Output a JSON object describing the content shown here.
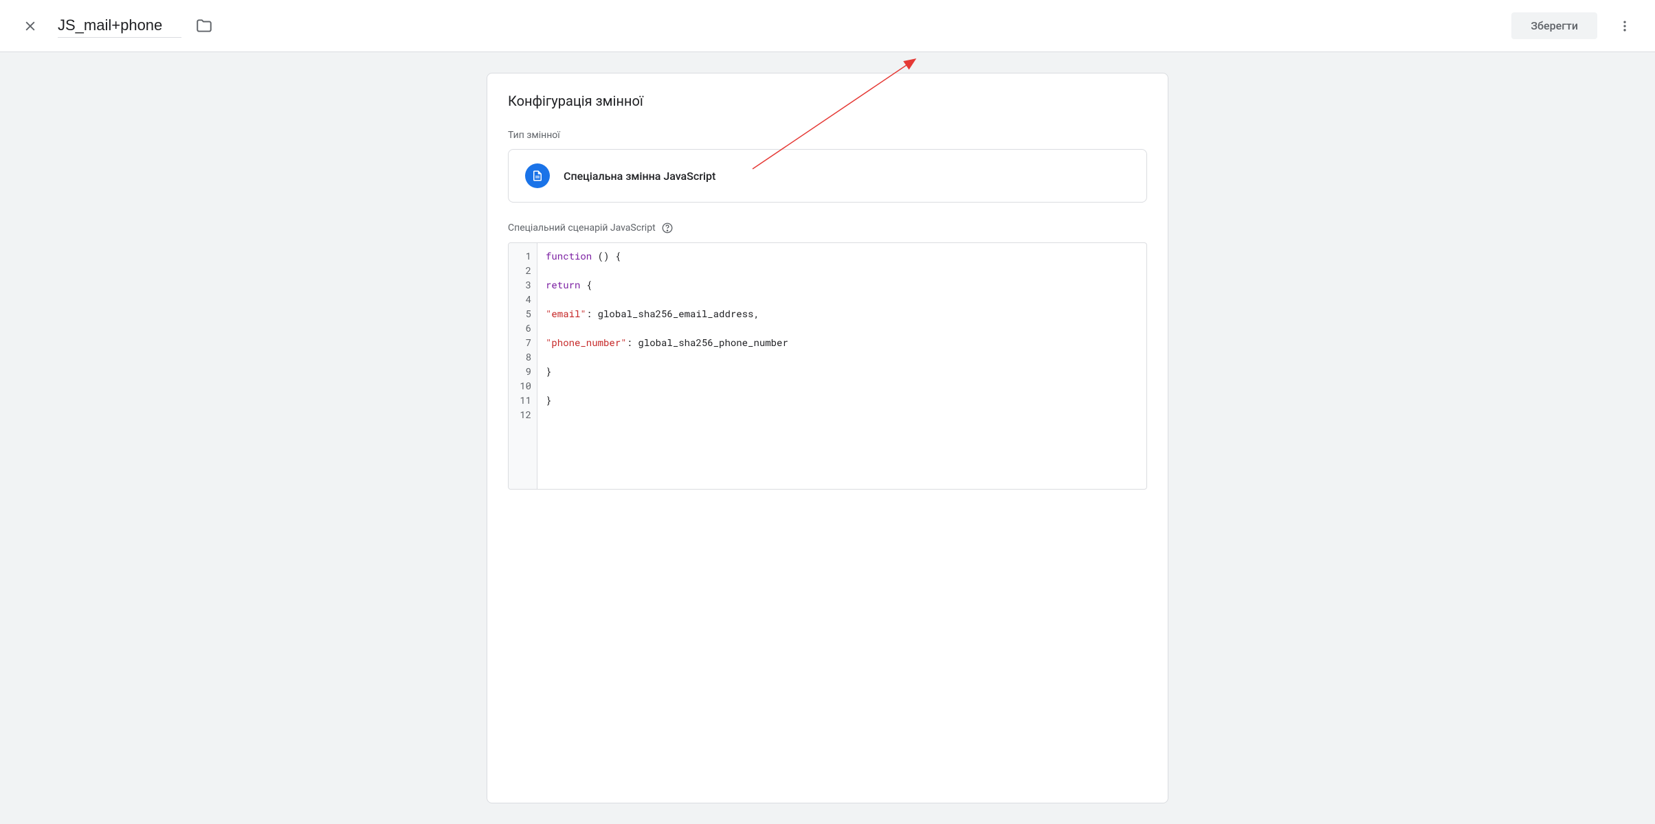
{
  "header": {
    "title": "JS_mail+phone",
    "save_label": "Зберегти"
  },
  "card": {
    "title": "Конфігурація змінної",
    "variable_type_label": "Тип змінної",
    "variable_type_name": "Спеціальна змінна JavaScript",
    "script_label": "Спеціальний сценарій JavaScript"
  },
  "code": {
    "lines": [
      {
        "n": "1",
        "tokens": [
          {
            "t": "kw",
            "v": "function"
          },
          {
            "t": "pln",
            "v": " () {"
          }
        ]
      },
      {
        "n": "2",
        "tokens": []
      },
      {
        "n": "3",
        "tokens": [
          {
            "t": "kw",
            "v": "return"
          },
          {
            "t": "pln",
            "v": " {"
          }
        ]
      },
      {
        "n": "4",
        "tokens": []
      },
      {
        "n": "5",
        "tokens": [
          {
            "t": "str",
            "v": "\"email\""
          },
          {
            "t": "pln",
            "v": ": global_sha256_email_address,"
          }
        ]
      },
      {
        "n": "6",
        "tokens": []
      },
      {
        "n": "7",
        "tokens": [
          {
            "t": "str",
            "v": "\"phone_number\""
          },
          {
            "t": "pln",
            "v": ": global_sha256_phone_number"
          }
        ]
      },
      {
        "n": "8",
        "tokens": []
      },
      {
        "n": "9",
        "tokens": [
          {
            "t": "pln",
            "v": "}"
          }
        ]
      },
      {
        "n": "10",
        "tokens": []
      },
      {
        "n": "11",
        "tokens": [
          {
            "t": "pln",
            "v": "}"
          }
        ]
      },
      {
        "n": "12",
        "tokens": []
      }
    ]
  }
}
